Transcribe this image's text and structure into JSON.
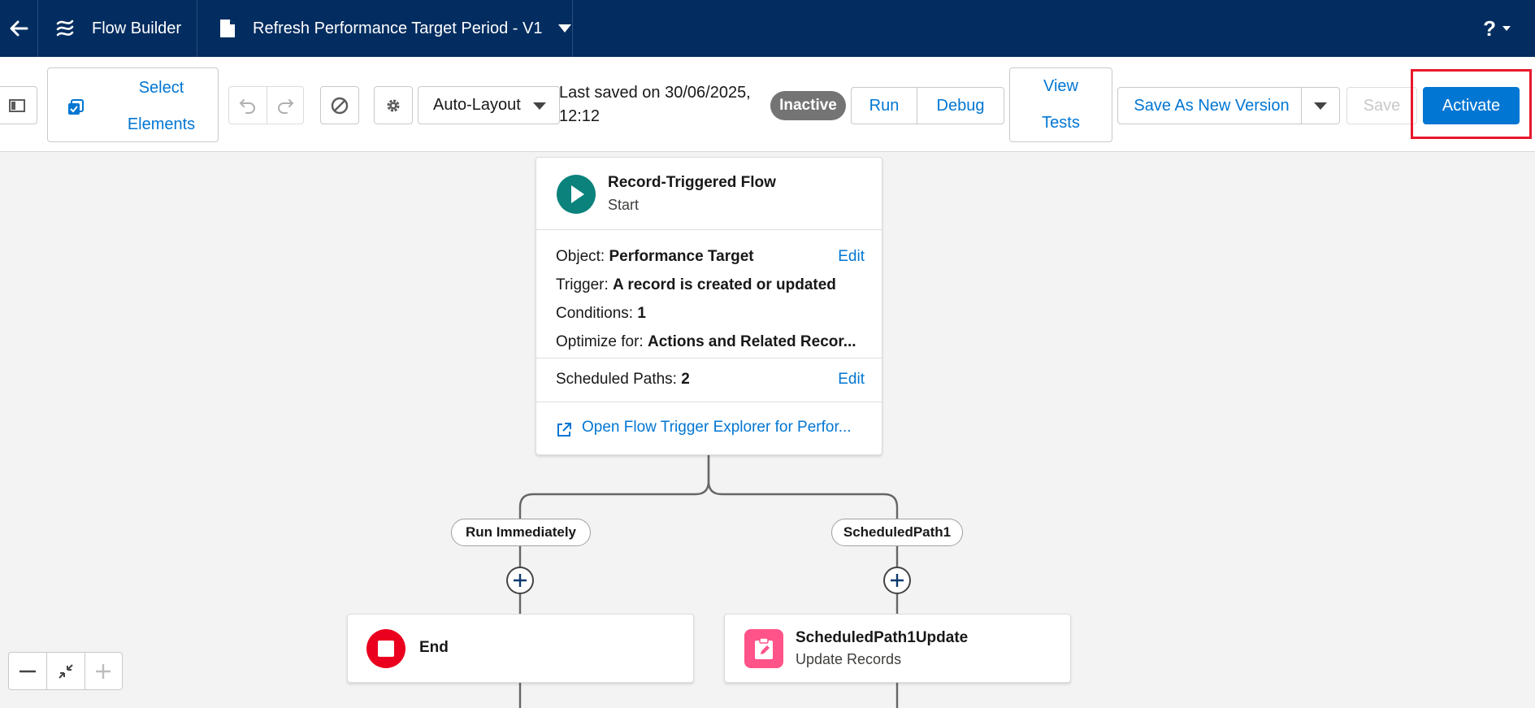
{
  "header": {
    "app_name": "Flow Builder",
    "flow_title": "Refresh Performance Target Period - V1",
    "help_label": "?"
  },
  "toolbar": {
    "select_elements_line1": "Select",
    "select_elements_line2": "Elements",
    "layout_mode": "Auto-Layout",
    "last_saved_line1": "Last saved on 30/06/2025,",
    "last_saved_line2": "12:12",
    "status_badge": "Inactive",
    "run_label": "Run",
    "debug_label": "Debug",
    "view_tests_line1": "View",
    "view_tests_line2": "Tests",
    "save_as_new_version_label": "Save As New Version",
    "save_label": "Save",
    "activate_label": "Activate"
  },
  "start_node": {
    "title": "Record-Triggered Flow",
    "subtitle": "Start",
    "object_label": "Object:",
    "object_value": "Performance Target",
    "trigger_label": "Trigger:",
    "trigger_value": "A record is created or updated",
    "conditions_label": "Conditions:",
    "conditions_value": "1",
    "optimize_label": "Optimize for:",
    "optimize_value": "Actions and Related Recor...",
    "edit_label": "Edit",
    "scheduled_paths_label": "Scheduled Paths:",
    "scheduled_paths_value": "2",
    "explorer_link": "Open Flow Trigger Explorer for Perfor..."
  },
  "paths": {
    "left_label": "Run Immediately",
    "right_label": "ScheduledPath1"
  },
  "end_node": {
    "label": "End"
  },
  "update_node": {
    "title": "ScheduledPath1Update",
    "subtitle": "Update Records"
  },
  "icons": {
    "back": "arrow-left-icon",
    "app_logo": "flow-icon",
    "file": "document-icon",
    "select": "select-checkbox-icon",
    "undo": "undo-icon",
    "redo": "redo-icon",
    "errors": "ban-icon",
    "settings": "gear-icon",
    "toggle_panel": "toggle-panel-icon",
    "external": "new-window-icon",
    "update": "edit-record-icon"
  },
  "colors": {
    "header_bg": "#032d60",
    "brand_blue": "#0176d3",
    "start_green": "#0b827c",
    "end_red": "#ea001e",
    "update_pink": "#ff538a",
    "highlight_red": "#e8182b",
    "inactive_gray": "#747474"
  }
}
